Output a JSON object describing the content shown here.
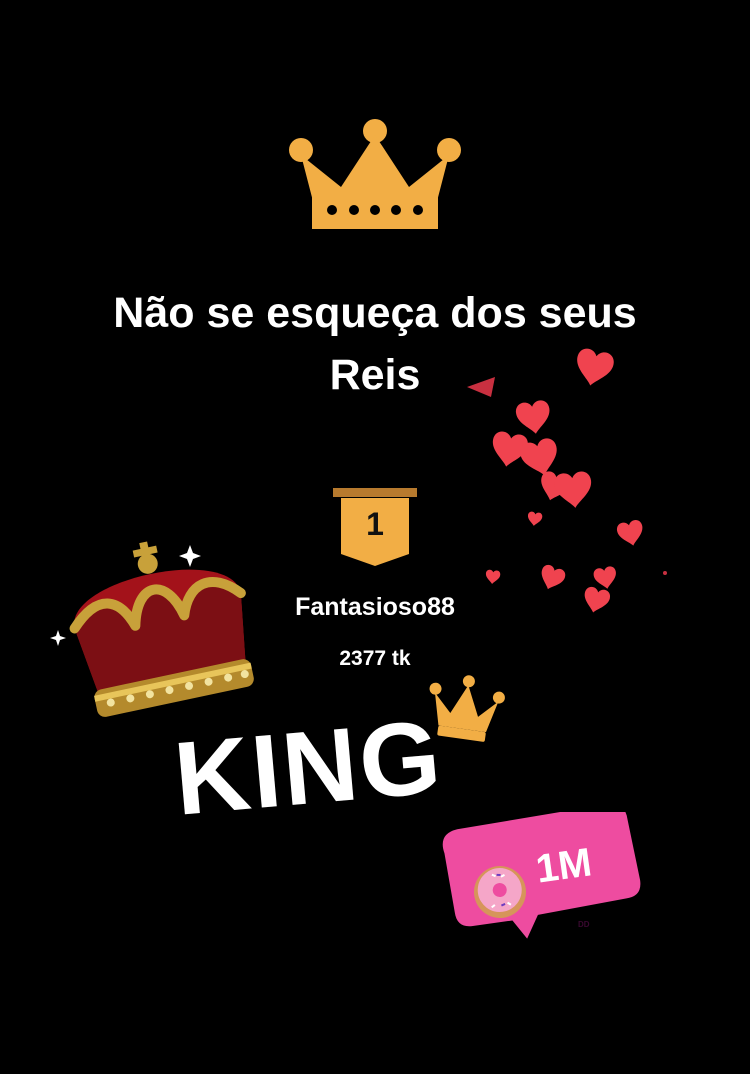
{
  "headline": {
    "line1": "Não se esqueça dos seus",
    "line2": "Reis"
  },
  "ranking": {
    "position": "1",
    "username": "Fantasioso88",
    "score": "2377 tk"
  },
  "stickers": {
    "king_text": "KING",
    "likes_count": "1M",
    "likes_tag": "DD"
  },
  "icons": {
    "top_crown": "crown-icon",
    "royal_crown": "royal-crown-icon",
    "small_crown": "crown-icon",
    "hearts": "heart-icon",
    "donut": "donut-icon",
    "badge": "rank-badge-icon"
  },
  "colors": {
    "background": "#000000",
    "crown_gold": "#F2AE45",
    "heart_red": "#F0434F",
    "sticker_pink": "#EE4CA0",
    "text": "#FFFFFF"
  }
}
